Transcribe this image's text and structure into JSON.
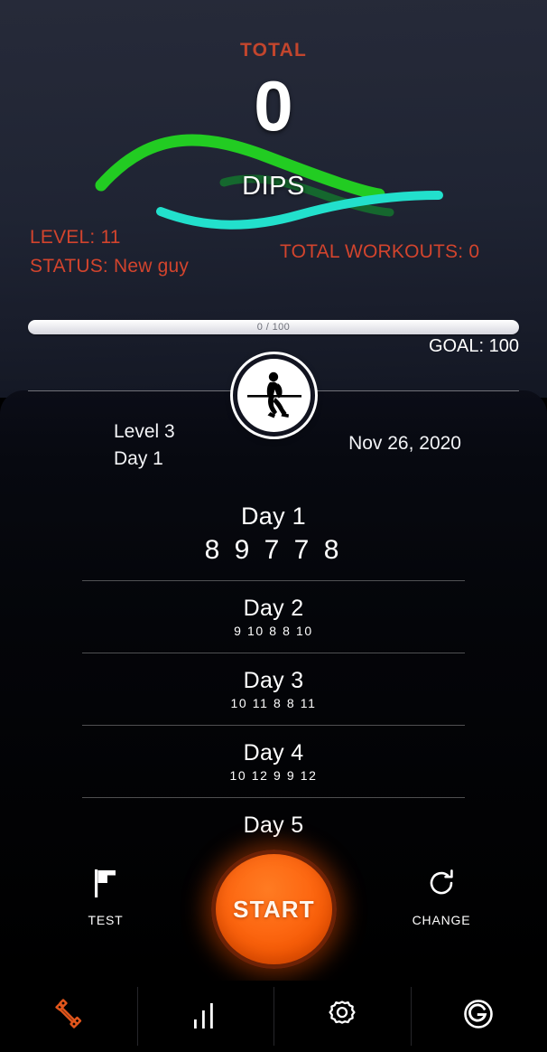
{
  "hero": {
    "total_label": "TOTAL",
    "total_value": "0",
    "exercise_name": "DIPS",
    "level_stat": "LEVEL: 11",
    "status_stat": "STATUS: New guy",
    "workouts_stat": "TOTAL WORKOUTS: 0",
    "progress_text": "0 / 100",
    "progress_percent": 0,
    "goal_text": "GOAL: 100",
    "accent_red": "#d2442d",
    "curve_green": "#22cc22",
    "curve_dark_green": "#156b2e",
    "curve_cyan": "#22e0cc"
  },
  "meta": {
    "level_line": "Level 3",
    "day_line": "Day 1",
    "date": "Nov 26, 2020",
    "avatar_icon": "dips-athlete-icon"
  },
  "days": [
    {
      "name": "Day 1",
      "reps": "8 9 7 7 8",
      "current": true
    },
    {
      "name": "Day 2",
      "reps": "9 10 8 8 10",
      "current": false
    },
    {
      "name": "Day 3",
      "reps": "10 11 8 8 11",
      "current": false
    },
    {
      "name": "Day 4",
      "reps": "10 12 9 9 12",
      "current": false
    },
    {
      "name": "Day 5",
      "reps": "",
      "current": false
    }
  ],
  "actions": {
    "test_label": "TEST",
    "test_icon": "flag-icon",
    "start_label": "START",
    "start_color": "#fd6812",
    "change_label": "CHANGE",
    "change_icon": "refresh-icon"
  },
  "bottom_nav": [
    {
      "name": "workout",
      "icon": "dumbbell-icon",
      "active": true,
      "color": "#e2561c"
    },
    {
      "name": "stats",
      "icon": "bar-chart-icon",
      "active": false,
      "color": "#ffffff"
    },
    {
      "name": "settings",
      "icon": "gear-icon",
      "active": false,
      "color": "#ffffff"
    },
    {
      "name": "account",
      "icon": "g-logo-icon",
      "active": false,
      "color": "#ffffff"
    }
  ]
}
